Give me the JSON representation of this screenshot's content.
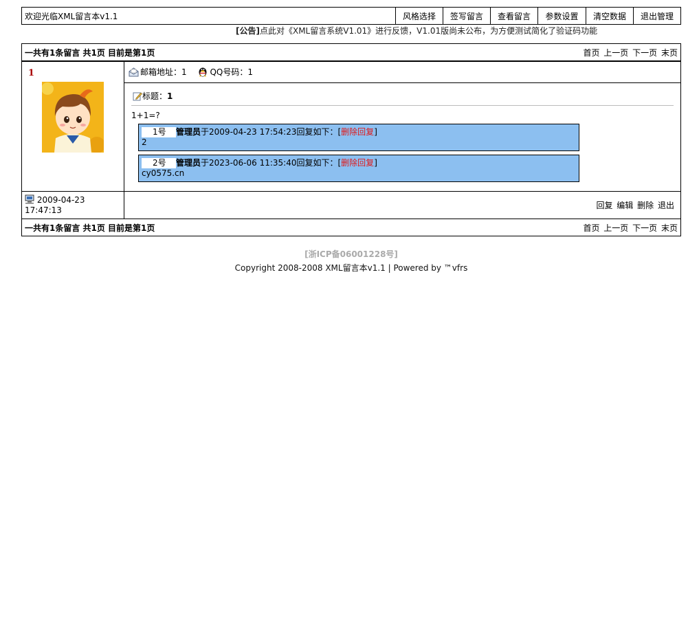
{
  "header": {
    "welcome": "欢迎光临XML留言本v1.1",
    "nav": [
      "风格选择",
      "签写留言",
      "查看留言",
      "参数设置",
      "清空数据",
      "退出管理"
    ]
  },
  "notice": {
    "label": "[公告]",
    "text": "点此对《XML留言系统V1.01》进行反馈，V1.01版尚未公布，为方便测试简化了验证码功能"
  },
  "pager": {
    "summary": "一共有1条留言 共1页 目前是第1页",
    "first": "首页",
    "prev": "上一页",
    "next": "下一页",
    "last": "末页"
  },
  "message": {
    "number": "1",
    "email_label": "邮箱地址：",
    "email": "1",
    "qq_label": "QQ号码：",
    "qq": "1",
    "title_label": "标题：",
    "title": "1",
    "content": "1+1=?",
    "date": "2009-04-23",
    "time": "17:47:13",
    "replies": [
      {
        "num": "1号",
        "author": "管理员",
        "prefix": "于",
        "datetime": "2009-04-23 17:54:23",
        "suffix": "回复如下：[",
        "delete": "删除回复",
        "close": "]",
        "text": "2"
      },
      {
        "num": "2号",
        "author": "管理员",
        "prefix": "于",
        "datetime": "2023-06-06 11:35:40",
        "suffix": "回复如下：[",
        "delete": "删除回复",
        "close": "]",
        "text": "cy0575.cn"
      }
    ],
    "actions": [
      "回复",
      "编辑",
      "删除",
      "退出"
    ]
  },
  "footer": {
    "icp": "[浙ICP备06001228号]",
    "copyright": "Copyright 2008-2008 XML留言本v1.1 | Powered by ™vfrs"
  },
  "colors": {
    "reply_bg": "#8cbff0",
    "delete_link": "#e01818",
    "number": "#aa0000"
  },
  "icons": [
    "email-icon",
    "qq-icon",
    "edit-icon",
    "computer-icon",
    "avatar-image"
  ]
}
